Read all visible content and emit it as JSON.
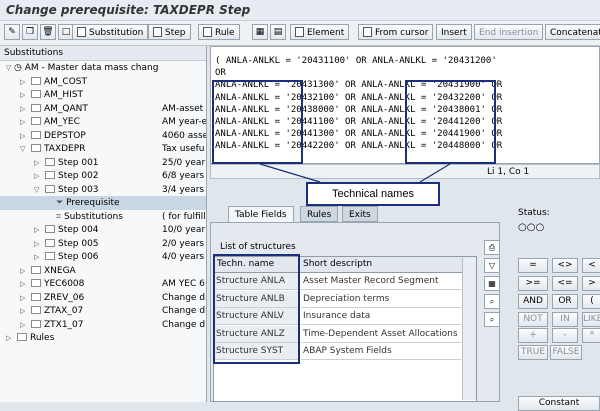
{
  "window": {
    "title": "Change prerequisite: TAXDEPR Step"
  },
  "toolbar": {
    "substitution": "Substitution",
    "step": "Step",
    "rule": "Rule",
    "element": "Element",
    "from_cursor": "From cursor",
    "insert": "Insert",
    "end_insertion": "End insertion",
    "concatenate": "Concatenate"
  },
  "tree": {
    "header": "Substitutions",
    "rows": [
      {
        "label": "AM - Master data mass chang",
        "desc": ""
      },
      {
        "label": "AM_COST",
        "desc": ""
      },
      {
        "label": "AM_HIST",
        "desc": ""
      },
      {
        "label": "AM_QANT",
        "desc": "AM-asset"
      },
      {
        "label": "AM_YEC",
        "desc": "AM year-e"
      },
      {
        "label": "DEPSTOP",
        "desc": "4060 asse"
      },
      {
        "label": "TAXDEPR",
        "desc": "Tax usefu"
      },
      {
        "label": "Step 001",
        "desc": "25/0 year"
      },
      {
        "label": "Step 002",
        "desc": "6/8 years"
      },
      {
        "label": "Step 003",
        "desc": "3/4 years"
      },
      {
        "label": "Prerequisite",
        "desc": ""
      },
      {
        "label": "Substitutions",
        "desc": "( for fulfill"
      },
      {
        "label": "Step 004",
        "desc": "10/0 year"
      },
      {
        "label": "Step 005",
        "desc": "2/0 years"
      },
      {
        "label": "Step 006",
        "desc": "4/0 years"
      },
      {
        "label": "XNEGA",
        "desc": ""
      },
      {
        "label": "YEC6008",
        "desc": "AM YEC 6"
      },
      {
        "label": "ZREV_06",
        "desc": "Change d"
      },
      {
        "label": "ZTAX_07",
        "desc": "Change d"
      },
      {
        "label": "ZTX1_07",
        "desc": "Change d"
      },
      {
        "label": "Rules",
        "desc": ""
      }
    ]
  },
  "code": {
    "lines": [
      "( ANLA-ANLKL = '20431100' OR ANLA-ANLKL = '20431200'",
      "OR",
      "ANLA-ANLKL = '20431300' OR ANLA-ANLKL = '20431900' OR",
      "ANLA-ANLKL = '20432100' OR ANLA-ANLKL = '20432200' OR",
      "ANLA-ANLKL = '20438000' OR ANLA-ANLKL = '20438001' OR",
      "ANLA-ANLKL = '20441100' OR ANLA-ANLKL = '20441200' OR",
      "ANLA-ANLKL = '20441300' OR ANLA-ANLKL = '20441900' OR",
      "ANLA-ANLKL = '20442200' OR ANLA-ANLKL = '20448000' OR"
    ],
    "cursor": "Li 1, Co 1"
  },
  "callout": "Technical names",
  "tabs": [
    "Table Fields",
    "Rules",
    "Exits"
  ],
  "structures": {
    "caption": "List of structures",
    "col_name": "Techn. name",
    "col_desc": "Short descriptn",
    "rows": [
      {
        "name": "Structure ANLA",
        "desc": "Asset Master Record Segment"
      },
      {
        "name": "Structure ANLB",
        "desc": "Depreciation terms"
      },
      {
        "name": "Structure ANLV",
        "desc": "Insurance data"
      },
      {
        "name": "Structure ANLZ",
        "desc": "Time-Dependent Asset Allocations"
      },
      {
        "name": "Structure SYST",
        "desc": "ABAP System Fields"
      }
    ]
  },
  "status": {
    "label": "Status:",
    "lights": "○○○"
  },
  "operators": [
    "=",
    "<>",
    "<",
    ">=",
    "<=",
    ">",
    "AND",
    "OR",
    "(",
    "NOT",
    "IN",
    "LIKE",
    "+",
    "-",
    "*",
    "TRUE",
    "FALSE",
    "Constant"
  ],
  "colors": {
    "highlight": "#1b2f7a",
    "selected_row": "#c9d6e3"
  }
}
